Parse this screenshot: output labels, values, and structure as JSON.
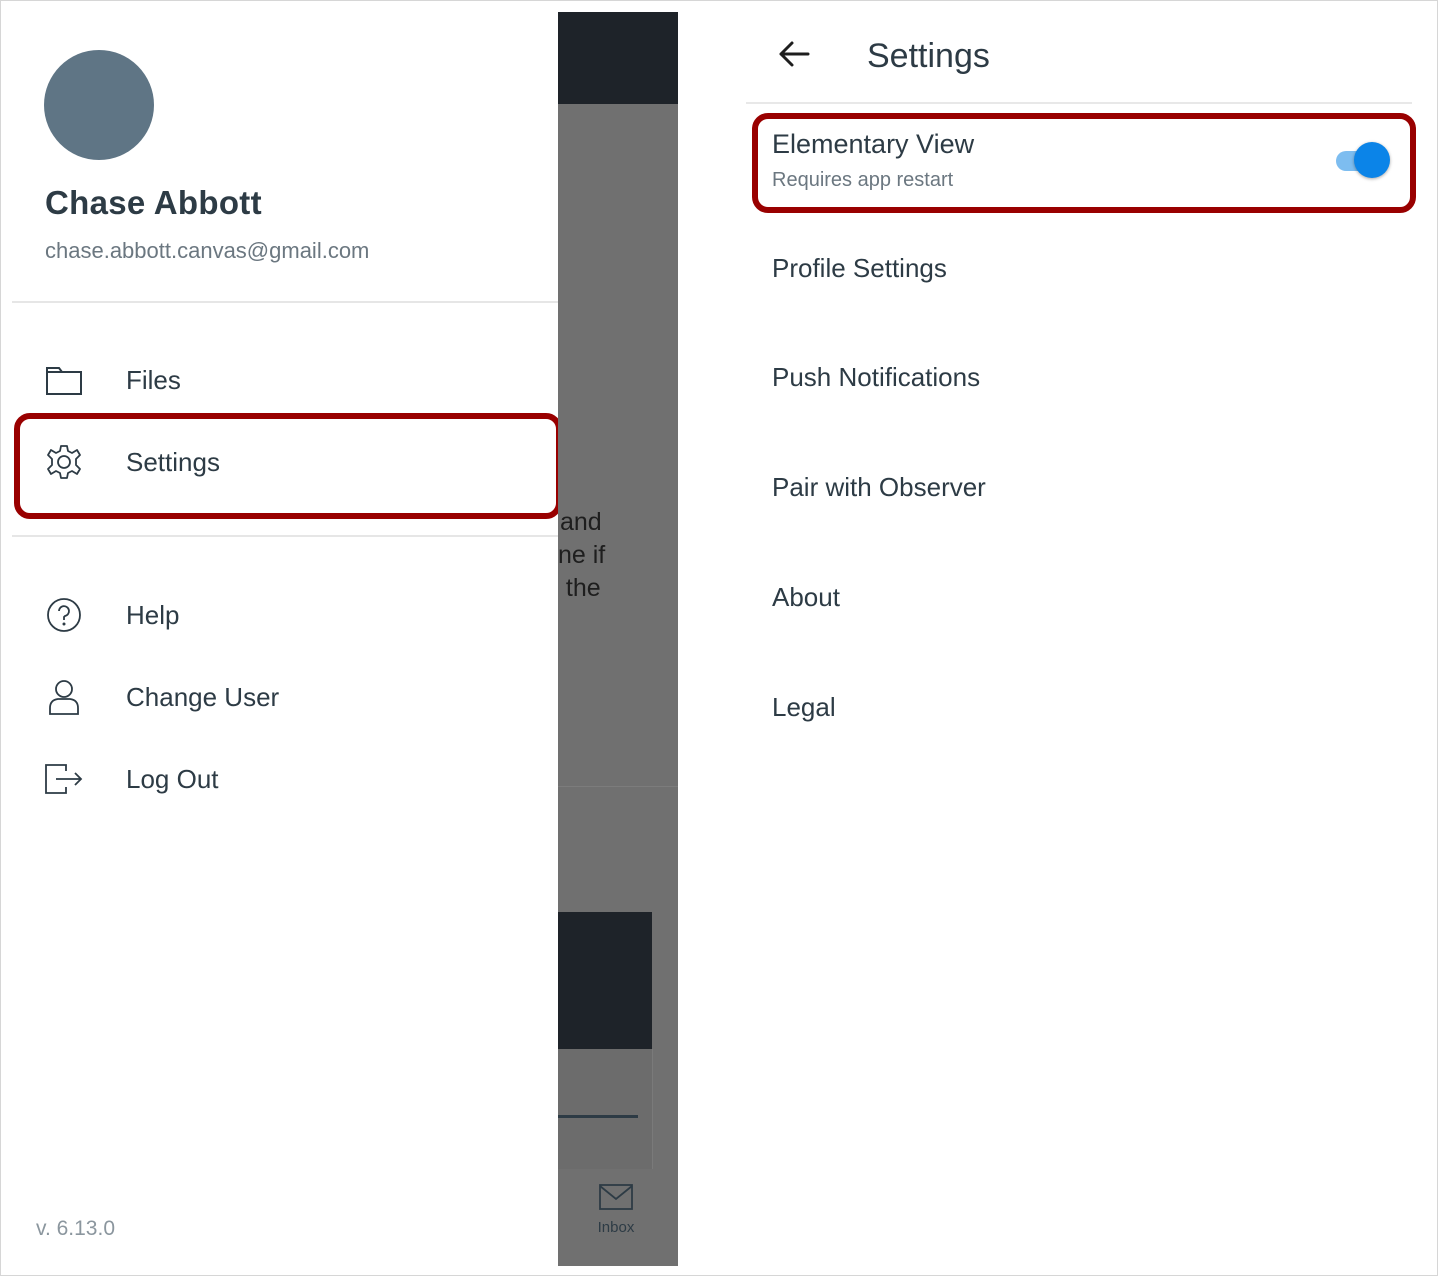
{
  "drawer": {
    "user_name": "Chase Abbott",
    "user_email": "chase.abbott.canvas@gmail.com",
    "items": [
      {
        "label": "Files",
        "icon": "folder-icon"
      },
      {
        "label": "Settings",
        "icon": "gear-icon"
      },
      {
        "label": "Help",
        "icon": "help-icon"
      },
      {
        "label": "Change User",
        "icon": "user-icon"
      },
      {
        "label": "Log Out",
        "icon": "logout-icon"
      }
    ],
    "version": "v. 6.13.0"
  },
  "background": {
    "text_lines": [
      "and",
      "ne if",
      ": the"
    ],
    "inbox_label": "Inbox"
  },
  "settings": {
    "title": "Settings",
    "elementary_view": {
      "title": "Elementary View",
      "subtitle": "Requires app restart",
      "enabled": true
    },
    "items": [
      "Profile Settings",
      "Push Notifications",
      "Pair with Observer",
      "About",
      "Legal"
    ]
  },
  "colors": {
    "highlight": "#990000",
    "toggle_on": "#0b84e8",
    "text": "#2d3b45",
    "avatar": "#5f7585"
  }
}
